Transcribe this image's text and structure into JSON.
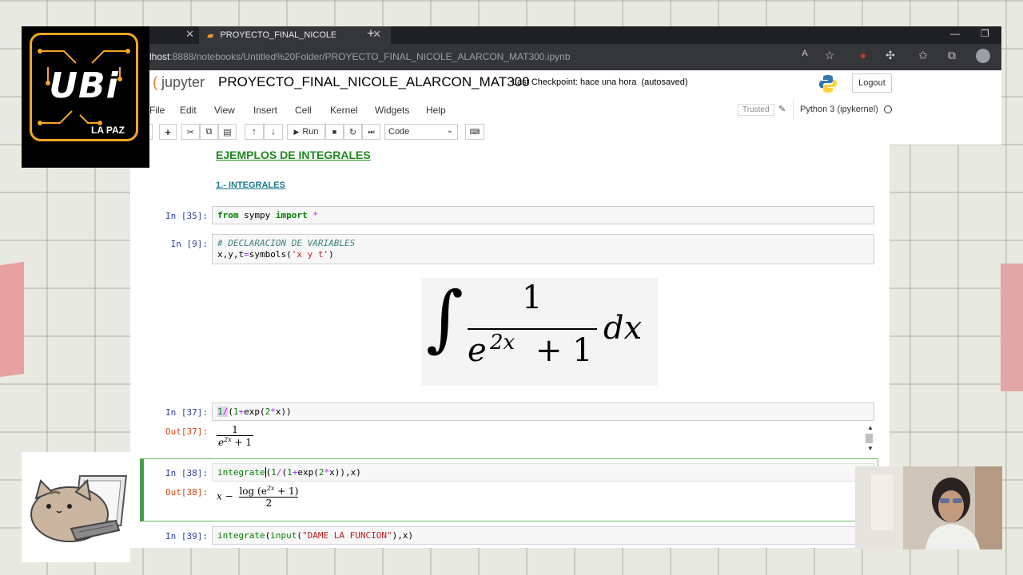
{
  "browser": {
    "tabs": [
      {
        "label": ""
      },
      {
        "label": "PROYECTO_FINAL_NICOLE_ALAR"
      }
    ],
    "url_host": "lhost",
    "url_rest": ":8888/notebooks/Untitled%20Folder/PROYECTO_FINAL_NICOLE_ALARCON_MAT300.ipynb"
  },
  "jupyter": {
    "logo": "jupyter",
    "notebook_name": "PROYECTO_FINAL_NICOLE_ALARCON_MAT300",
    "checkpoint": "Last Checkpoint: hace una hora",
    "autosaved": "(autosaved)",
    "logout": "Logout",
    "menu": [
      "File",
      "Edit",
      "View",
      "Insert",
      "Cell",
      "Kernel",
      "Widgets",
      "Help"
    ],
    "trusted": "Trusted",
    "kernel": "Python 3 (ipykernel)",
    "run_label": "Run",
    "cell_type": "Code"
  },
  "notebook": {
    "heading": "EJEMPLOS DE INTEGRALES",
    "subheading": "1.- INTEGRALES",
    "prompts": {
      "in35": "In [35]:",
      "in9": "In [9]:",
      "in37": "In [37]:",
      "out37": "Out[37]:",
      "in38": "In [38]:",
      "out38": "Out[38]:",
      "in39": "In [39]:"
    },
    "latex": {
      "num": "1",
      "base": "e",
      "exp": "2x",
      "plus": "+ 1",
      "dx": "dx"
    },
    "out37": {
      "num": "1",
      "den_base": "e",
      "den_exp": "2x",
      "den_rest": " + 1"
    },
    "out38": {
      "x": "x −",
      "num": "log (e",
      "num_exp": "2x",
      "num_rest": " + 1)",
      "den": "2"
    }
  },
  "overlays": {
    "ubi_text": "UBi",
    "ubi_sub": "LA PAZ"
  },
  "colors": {
    "heading_green": "#1e8a1e",
    "subheading_teal": "#1a7a8a",
    "prompt_in": "#303f9f",
    "prompt_out": "#d84315",
    "ubi_orange": "#f5a623"
  }
}
